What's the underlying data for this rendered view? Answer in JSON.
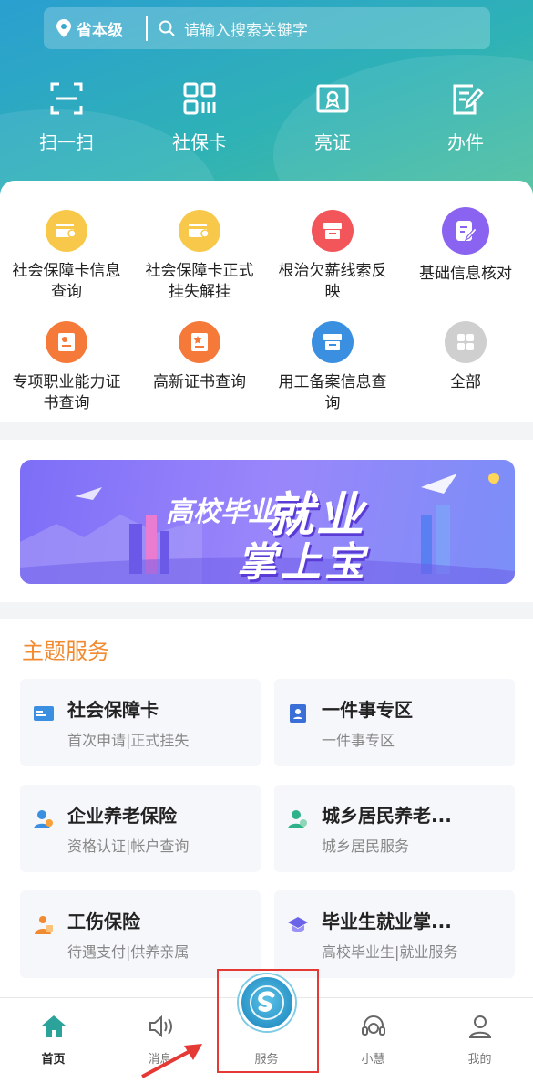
{
  "header": {
    "location": "省本级",
    "search_placeholder": "请输入搜索关键字",
    "quick_actions": [
      {
        "label": "扫一扫",
        "icon": "scan-icon"
      },
      {
        "label": "社保卡",
        "icon": "qrcode-icon"
      },
      {
        "label": "亮证",
        "icon": "certificate-icon"
      },
      {
        "label": "办件",
        "icon": "edit-document-icon"
      }
    ]
  },
  "services_grid": [
    {
      "label": "社会保障卡信息查询",
      "icon": "card-search-icon",
      "color": "#f8c84a"
    },
    {
      "label": "社会保障卡正式挂失解挂",
      "icon": "card-lock-icon",
      "color": "#f8c84a"
    },
    {
      "label": "根治欠薪线索反映",
      "icon": "wage-report-icon",
      "color": "#f2565a"
    },
    {
      "label": "基础信息核对",
      "icon": "info-check-icon",
      "color": "#8a63f0"
    },
    {
      "label": "专项职业能力证书查询",
      "icon": "certificate-search-icon",
      "color": "#f57a3a"
    },
    {
      "label": "高新证书查询",
      "icon": "star-certificate-icon",
      "color": "#f57a3a"
    },
    {
      "label": "用工备案信息查询",
      "icon": "employment-record-icon",
      "color": "#3a8fe0"
    },
    {
      "label": "全部",
      "icon": "grid-all-icon",
      "color": "#cfcfcf"
    }
  ],
  "banner": {
    "line1": "高校毕业生",
    "line2": "就业",
    "line3": "掌上宝"
  },
  "theme_services": {
    "title": "主题服务",
    "items": [
      {
        "title": "社会保障卡",
        "subtitle": "首次申请|正式挂失",
        "icon": "id-card-icon"
      },
      {
        "title": "一件事专区",
        "subtitle": "一件事专区",
        "icon": "contact-book-icon"
      },
      {
        "title": "企业养老保险",
        "subtitle": "资格认证|帐户查询",
        "icon": "person-pension-icon"
      },
      {
        "title": "城乡居民养老...",
        "subtitle": "城乡居民服务",
        "icon": "person-resident-icon"
      },
      {
        "title": "工伤保险",
        "subtitle": "待遇支付|供养亲属",
        "icon": "injury-insurance-icon"
      },
      {
        "title": "毕业生就业掌...",
        "subtitle": "高校毕业生|就业服务",
        "icon": "graduate-cap-icon"
      }
    ]
  },
  "tabbar": [
    {
      "label": "首页",
      "icon": "home-icon",
      "active": true
    },
    {
      "label": "消息",
      "icon": "speaker-icon",
      "active": false
    },
    {
      "label": "服务",
      "icon": "service-logo-icon",
      "active": false
    },
    {
      "label": "小慧",
      "icon": "headset-icon",
      "active": false
    },
    {
      "label": "我的",
      "icon": "user-icon",
      "active": false
    }
  ],
  "colors": {
    "accent_orange": "#f28a2f",
    "active_tab": "#2ba39b",
    "highlight_red": "#e53935"
  }
}
